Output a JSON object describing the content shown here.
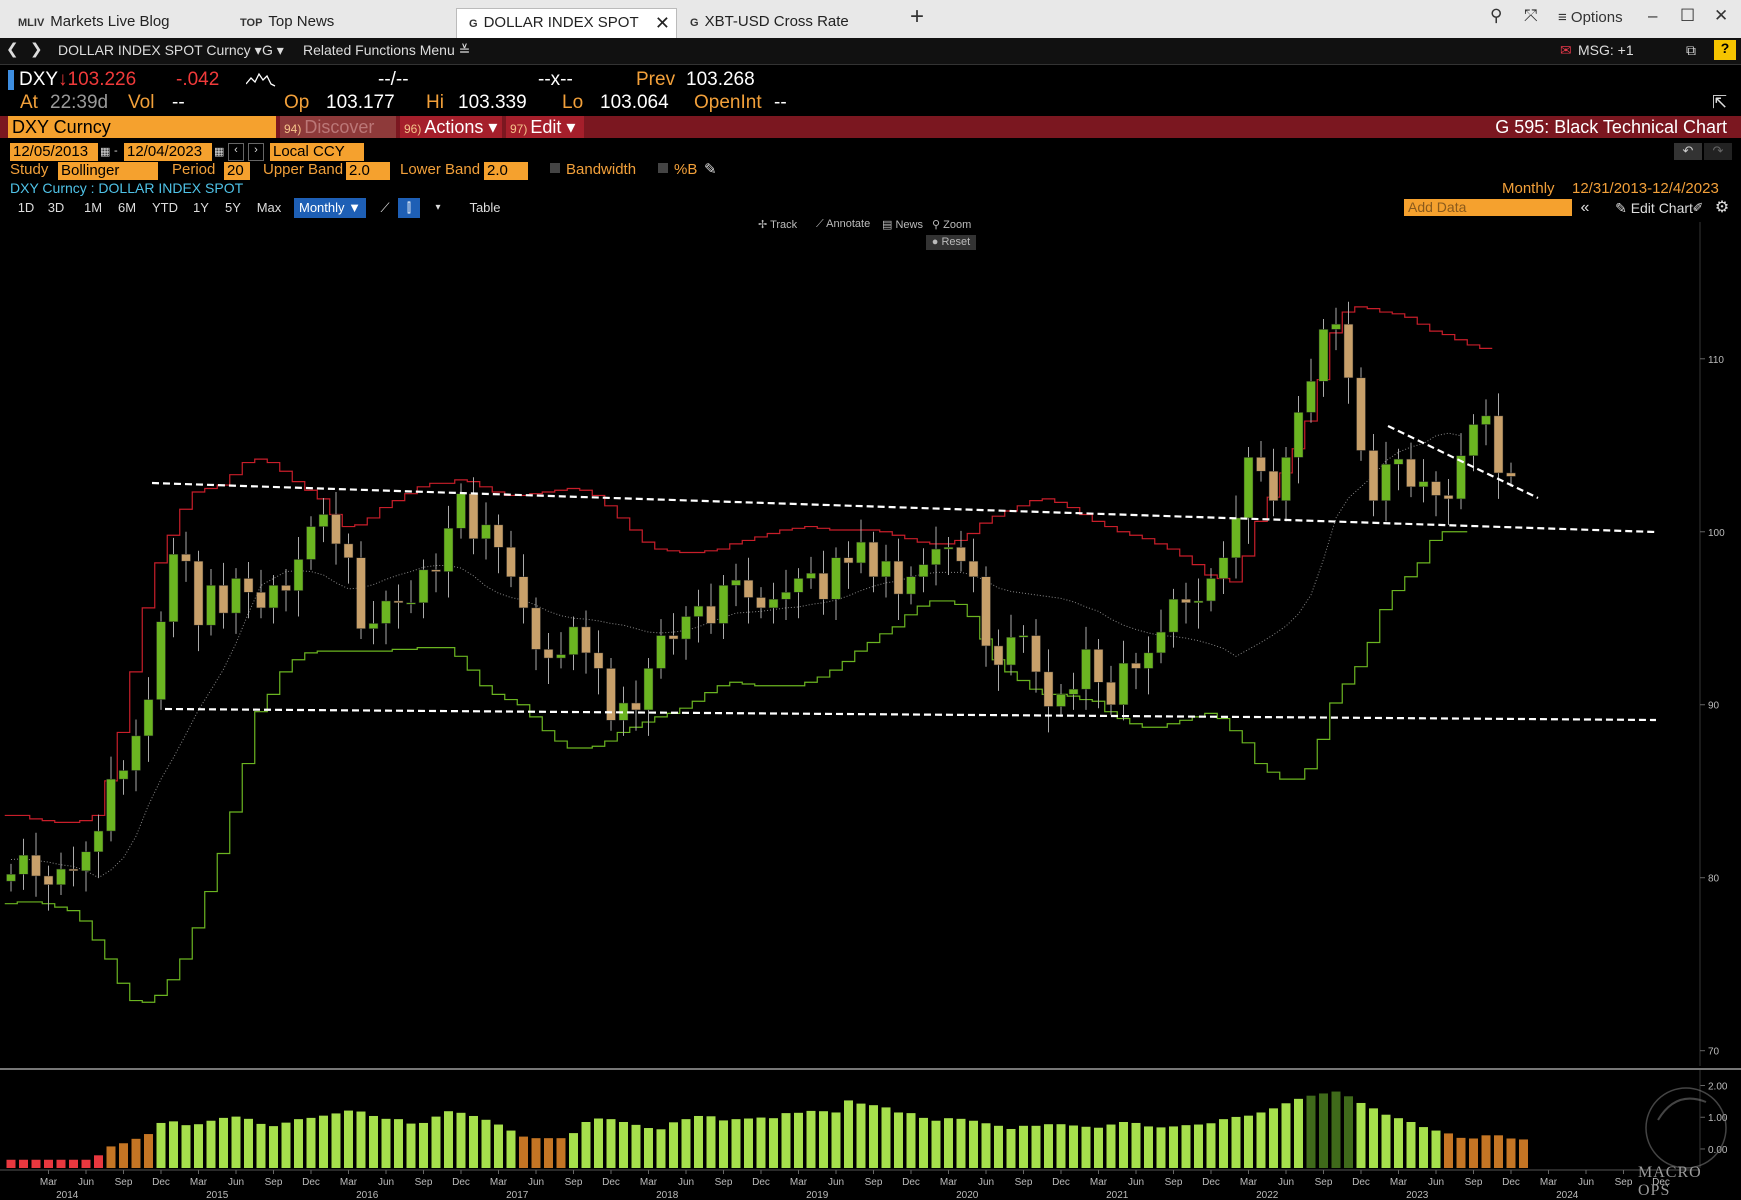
{
  "tabs": [
    {
      "prefix": "MLIV",
      "label": "Markets Live Blog"
    },
    {
      "prefix": "TOP",
      "label": "Top News"
    },
    {
      "prefix": "G",
      "label": "DOLLAR INDEX SPOT Curncy"
    },
    {
      "prefix": "G",
      "label": "XBT-USD Cross Rate Curncy"
    }
  ],
  "window": {
    "add_tab": "+",
    "options": "≡ Options"
  },
  "nav": {
    "security": "DOLLAR INDEX SPOT Curncy ▾",
    "func": "G ▾",
    "related": "Related Functions Menu ≚",
    "msg": "MSG: +1",
    "help": "?"
  },
  "quote": {
    "ticker": "DXY",
    "last": "↓103.226",
    "change": "-.042",
    "bid_ask": "--/--",
    "x": "--x--",
    "prev_label": "Prev",
    "prev": "103.268",
    "at_label": "At",
    "time": "22:39d",
    "vol_label": "Vol",
    "vol": "--",
    "op_label": "Op",
    "op": "103.177",
    "hi_label": "Hi",
    "hi": "103.339",
    "lo_label": "Lo",
    "lo": "103.064",
    "oi_label": "OpenInt",
    "oi": "--"
  },
  "secbar": {
    "field": "DXY Curncy",
    "discover_num": "94)",
    "discover": "Discover",
    "actions_num": "96)",
    "actions": "Actions ▾",
    "edit_num": "97)",
    "edit": "Edit ▾",
    "title": "G 595: Black Technical Chart"
  },
  "dates": {
    "start": "12/05/2013",
    "end": "12/04/2023",
    "dash": "-",
    "ccy": "Local CCY"
  },
  "study": {
    "label": "Study",
    "value": "Bollinger",
    "period_label": "Period",
    "period": "20",
    "upper_label": "Upper Band",
    "upper": "2.0",
    "lower_label": "Lower Band",
    "lower": "2.0",
    "bandwidth": "Bandwidth",
    "pctb": "%B"
  },
  "chart_header": {
    "name": "DXY Curncy : DOLLAR INDEX SPOT",
    "freq": "Monthly",
    "range": "12/31/2013-12/4/2023"
  },
  "ranges": [
    "1D",
    "3D",
    "1M",
    "6M",
    "YTD",
    "1Y",
    "5Y",
    "Max"
  ],
  "freq_select": "Monthly ▼",
  "table_label": "Table",
  "add_data_placeholder": "Add Data",
  "edit_chart": "Edit Chart",
  "toolbar": {
    "track": "Track",
    "annotate": "Annotate",
    "news": "News",
    "zoom": "Zoom",
    "reset": "Reset"
  },
  "colors": {
    "up": "#6bb521",
    "down": "#c8a06a",
    "upper_band": "#c81e2a",
    "lower_band": "#6bb521",
    "mid": "#888888",
    "bw_red": "#e8383f",
    "bw_orange": "#c47524",
    "bw_green": "#a6df4c",
    "bw_dark": "#3f6a1a"
  },
  "watermark": "MACRO OPS",
  "chart_data": {
    "type": "candlestick",
    "title": "DXY Curncy : DOLLAR INDEX SPOT",
    "frequency": "Monthly",
    "x_range": [
      "Dec 2013",
      "Dec 2024"
    ],
    "ylim": [
      69,
      116
    ],
    "yticks": [
      70,
      80,
      90,
      100,
      110
    ],
    "months": [
      "Mar",
      "Jun",
      "Sep",
      "Dec"
    ],
    "years": [
      "2014",
      "2015",
      "2016",
      "2017",
      "2018",
      "2019",
      "2020",
      "2021",
      "2022",
      "2023"
    ],
    "closes": [
      80.2,
      81.3,
      80.1,
      79.6,
      80.5,
      80.4,
      81.5,
      82.7,
      85.7,
      86.2,
      88.2,
      90.3,
      94.8,
      98.7,
      98.3,
      94.6,
      96.9,
      95.3,
      97.3,
      96.5,
      95.6,
      96.9,
      96.6,
      98.4,
      100.3,
      101.0,
      99.3,
      98.5,
      94.4,
      94.7,
      96.0,
      95.9,
      95.9,
      97.8,
      97.7,
      100.2,
      102.2,
      99.6,
      100.4,
      99.1,
      97.4,
      95.6,
      93.2,
      92.7,
      92.9,
      94.5,
      93.0,
      92.1,
      89.1,
      90.1,
      89.7,
      92.1,
      94.0,
      93.8,
      95.1,
      95.7,
      94.7,
      96.9,
      97.2,
      96.2,
      95.6,
      96.1,
      96.5,
      97.3,
      97.6,
      96.1,
      98.5,
      98.2,
      99.4,
      97.4,
      98.3,
      96.4,
      97.4,
      98.1,
      99.0,
      99.1,
      98.3,
      97.4,
      93.4,
      92.3,
      93.9,
      94.0,
      91.9,
      89.9,
      90.6,
      90.9,
      93.2,
      91.3,
      90.0,
      92.4,
      92.1,
      93.0,
      94.2,
      96.1,
      95.9,
      96.0,
      97.3,
      98.5,
      100.8,
      104.3,
      103.5,
      101.8,
      104.3,
      106.9,
      108.7,
      111.7,
      112.0,
      108.9,
      104.7,
      101.8,
      103.9,
      104.2,
      102.6,
      102.9,
      102.1,
      101.9,
      104.4,
      106.2,
      106.7,
      103.4,
      103.2
    ],
    "upper_band": [
      83.6,
      83.6,
      83.4,
      83.3,
      83.2,
      83.2,
      83.3,
      83.6,
      85.6,
      88.4,
      91.9,
      95.6,
      98.2,
      99.8,
      101.3,
      102.3,
      102.5,
      102.7,
      103.3,
      104.0,
      104.2,
      104.0,
      103.5,
      102.9,
      102.4,
      101.9,
      101.0,
      100.3,
      100.4,
      100.8,
      101.4,
      101.8,
      102.2,
      102.6,
      102.8,
      102.8,
      103.0,
      102.9,
      102.6,
      102.3,
      102.1,
      102.1,
      102.2,
      102.3,
      102.4,
      102.5,
      102.4,
      102.1,
      101.5,
      100.8,
      100.1,
      99.4,
      99.0,
      98.9,
      98.8,
      98.8,
      98.9,
      99.0,
      99.3,
      99.5,
      99.7,
      99.9,
      100.1,
      100.2,
      100.3,
      100.2,
      100.1,
      100.1,
      100.1,
      100.1,
      100.0,
      99.8,
      99.6,
      99.4,
      99.3,
      99.3,
      99.5,
      99.9,
      100.5,
      100.9,
      101.2,
      101.5,
      101.8,
      101.9,
      101.7,
      101.4,
      101.0,
      100.6,
      100.3,
      100.0,
      99.8,
      99.6,
      99.3,
      99.0,
      98.6,
      98.1,
      97.5,
      97.3,
      97.1,
      98.6,
      100.6,
      102.0,
      103.4,
      104.8,
      106.4,
      108.8,
      111.5,
      112.7,
      113.0,
      112.9,
      112.7,
      112.6,
      112.4,
      112.0,
      111.6,
      111.4,
      111.1,
      110.8,
      110.6
    ],
    "lower_band": [
      78.5,
      78.6,
      78.6,
      78.5,
      78.3,
      78.1,
      77.5,
      76.4,
      75.3,
      73.9,
      72.9,
      72.8,
      73.2,
      74.1,
      75.3,
      77.1,
      79.2,
      81.4,
      83.8,
      86.6,
      89.6,
      90.6,
      91.9,
      92.6,
      93.0,
      93.1,
      93.1,
      93.1,
      93.1,
      93.1,
      93.1,
      93.2,
      93.2,
      93.3,
      93.3,
      93.3,
      92.8,
      92.0,
      91.1,
      90.6,
      90.3,
      90.0,
      89.3,
      88.5,
      87.9,
      87.5,
      87.5,
      87.6,
      87.9,
      88.4,
      88.7,
      89.0,
      89.3,
      89.5,
      89.8,
      90.2,
      90.7,
      91.1,
      91.3,
      91.2,
      91.1,
      91.1,
      91.1,
      91.1,
      91.3,
      91.6,
      92.0,
      92.5,
      93.1,
      93.6,
      94.1,
      94.5,
      95.2,
      95.7,
      96.0,
      96.0,
      95.8,
      95.1,
      93.8,
      92.6,
      91.9,
      91.4,
      90.9,
      90.6,
      90.6,
      90.5,
      90.3,
      90.2,
      89.6,
      89.2,
      88.9,
      88.7,
      88.7,
      88.9,
      89.1,
      89.3,
      89.5,
      89.2,
      88.5,
      87.8,
      86.6,
      86.1,
      85.7,
      85.7,
      86.3,
      88.0,
      90.1,
      91.2,
      92.2,
      93.6,
      95.5,
      96.6,
      97.4,
      98.2,
      99.5,
      100.0,
      100.0
    ],
    "bandwidth_ylim": [
      -0.6,
      2.3
    ],
    "bandwidth": [
      -0.34,
      -0.34,
      -0.34,
      -0.34,
      -0.34,
      -0.34,
      -0.34,
      -0.2,
      0.08,
      0.18,
      0.32,
      0.47,
      0.82,
      0.87,
      0.75,
      0.78,
      0.89,
      0.98,
      1.02,
      0.95,
      0.79,
      0.72,
      0.83,
      0.94,
      0.98,
      1.05,
      1.12,
      1.21,
      1.18,
      1.04,
      0.95,
      0.94,
      0.8,
      0.82,
      1.02,
      1.19,
      1.14,
      1.04,
      0.92,
      0.77,
      0.58,
      0.39,
      0.34,
      0.34,
      0.34,
      0.5,
      0.85,
      0.96,
      0.94,
      0.85,
      0.76,
      0.66,
      0.62,
      0.84,
      0.94,
      1.04,
      1.03,
      0.9,
      0.94,
      0.96,
      0.99,
      0.97,
      1.13,
      1.14,
      1.2,
      1.19,
      1.15,
      1.53,
      1.43,
      1.38,
      1.31,
      1.15,
      1.13,
      0.98,
      0.89,
      0.97,
      0.95,
      0.89,
      0.81,
      0.73,
      0.63,
      0.73,
      0.73,
      0.78,
      0.78,
      0.74,
      0.7,
      0.67,
      0.77,
      0.85,
      0.82,
      0.71,
      0.68,
      0.71,
      0.75,
      0.77,
      0.81,
      0.94,
      1.01,
      1.05,
      1.15,
      1.28,
      1.44,
      1.58,
      1.68,
      1.75,
      1.81,
      1.66,
      1.45,
      1.28,
      1.08,
      0.97,
      0.85,
      0.69,
      0.58,
      0.49,
      0.35,
      0.33,
      0.43,
      0.43,
      0.33,
      0.3
    ]
  }
}
